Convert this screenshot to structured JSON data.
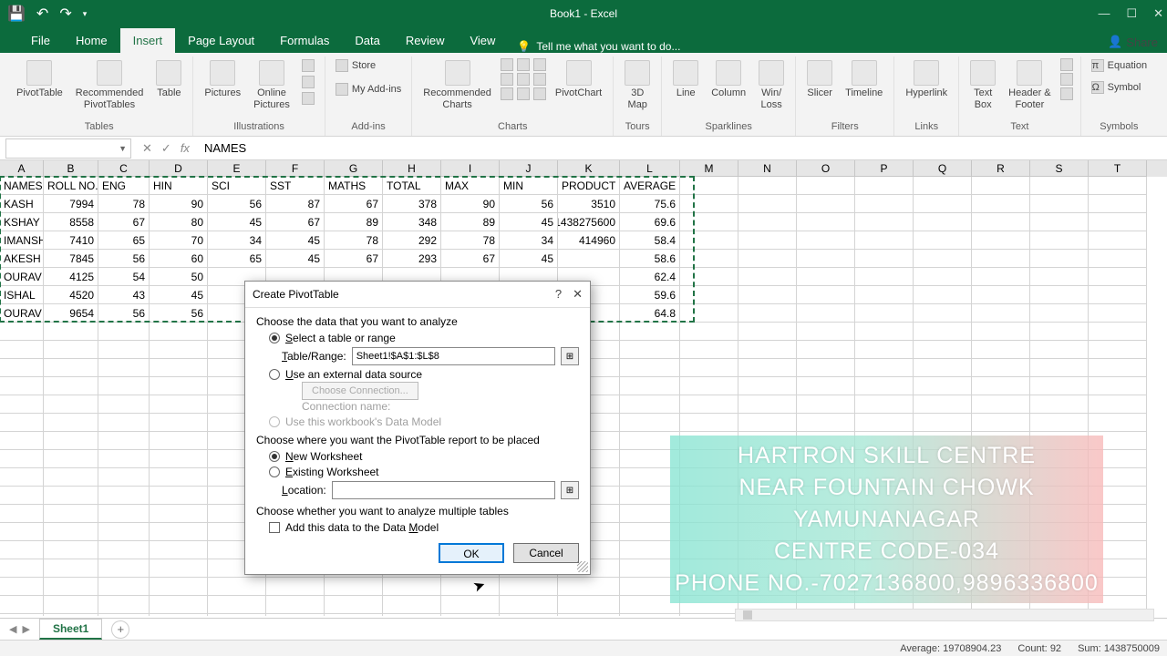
{
  "app": {
    "title": "Book1 - Excel"
  },
  "tabs": [
    "File",
    "Home",
    "Insert",
    "Page Layout",
    "Formulas",
    "Data",
    "Review",
    "View"
  ],
  "active_tab": "Insert",
  "tell_me": "Tell me what you want to do...",
  "share": "Share",
  "ribbon": {
    "tables": {
      "pivot": "PivotTable",
      "recommended": "Recommended\nPivotTables",
      "table": "Table",
      "group": "Tables"
    },
    "illustrations": {
      "pictures": "Pictures",
      "online": "Online\nPictures",
      "group": "Illustrations"
    },
    "addins": {
      "store": "Store",
      "my": "My Add-ins",
      "group": "Add-ins"
    },
    "charts": {
      "recommended": "Recommended\nCharts",
      "pivotchart": "PivotChart",
      "group": "Charts"
    },
    "tours": {
      "map": "3D\nMap",
      "group": "Tours"
    },
    "sparklines": {
      "line": "Line",
      "column": "Column",
      "winloss": "Win/\nLoss",
      "group": "Sparklines"
    },
    "filters": {
      "slicer": "Slicer",
      "timeline": "Timeline",
      "group": "Filters"
    },
    "links": {
      "hyperlink": "Hyperlink",
      "group": "Links"
    },
    "text": {
      "textbox": "Text\nBox",
      "header": "Header &\nFooter",
      "group": "Text"
    },
    "symbols": {
      "equation": "Equation",
      "symbol": "Symbol",
      "group": "Symbols"
    }
  },
  "formula_bar": {
    "name_box": "",
    "value": "NAMES",
    "fx": "fx"
  },
  "columns": [
    "A",
    "B",
    "C",
    "D",
    "E",
    "F",
    "G",
    "H",
    "I",
    "J",
    "K",
    "L",
    "M",
    "N",
    "O",
    "P",
    "Q",
    "R",
    "S",
    "T"
  ],
  "headers": [
    "NAMES",
    "ROLL NO.",
    "ENG",
    "HIN",
    "SCI",
    "SST",
    "MATHS",
    "TOTAL",
    "MAX",
    "MIN",
    "PRODUCT",
    "AVERAGE"
  ],
  "rows": [
    {
      "n": "KASH",
      "r": 7994,
      "c": [
        78,
        90,
        56,
        87,
        67,
        378,
        90,
        56,
        3510,
        75.6
      ]
    },
    {
      "n": "KSHAY",
      "r": 8558,
      "c": [
        67,
        80,
        45,
        67,
        89,
        348,
        89,
        45,
        1438275600,
        69.6
      ]
    },
    {
      "n": "IMANSH",
      "r": 7410,
      "c": [
        65,
        70,
        34,
        45,
        78,
        292,
        78,
        34,
        414960,
        58.4
      ]
    },
    {
      "n": "AKESH",
      "r": 7845,
      "c": [
        56,
        60,
        65,
        45,
        67,
        293,
        67,
        45,
        null,
        58.6
      ]
    },
    {
      "n": "OURAV",
      "r": 4125,
      "c": [
        54,
        50,
        null,
        null,
        null,
        null,
        null,
        null,
        null,
        62.4
      ]
    },
    {
      "n": "ISHAL",
      "r": 4520,
      "c": [
        43,
        45,
        null,
        null,
        null,
        null,
        null,
        null,
        null,
        59.6
      ]
    },
    {
      "n": "OURAV",
      "r": 9654,
      "c": [
        56,
        56,
        null,
        null,
        null,
        null,
        null,
        null,
        null,
        64.8
      ]
    }
  ],
  "dialog": {
    "title": "Create PivotTable",
    "section1": "Choose the data that you want to analyze",
    "opt_select": "Select a table or range",
    "table_range_label": "Table/Range:",
    "table_range_value": "Sheet1!$A$1:$L$8",
    "opt_external": "Use an external data source",
    "choose_conn": "Choose Connection...",
    "conn_name": "Connection name:",
    "opt_datamodel": "Use this workbook's Data Model",
    "section2": "Choose where you want the PivotTable report to be placed",
    "opt_new": "New Worksheet",
    "opt_existing": "Existing Worksheet",
    "location_label": "Location:",
    "section3": "Choose whether you want to analyze multiple tables",
    "chk_add": "Add this data to the Data Model",
    "ok": "OK",
    "cancel": "Cancel"
  },
  "watermark": {
    "l1": "HARTRON SKILL CENTRE",
    "l2": "NEAR FOUNTAIN CHOWK",
    "l3": "YAMUNANAGAR",
    "l4": "CENTRE CODE-034",
    "l5": "PHONE NO.-7027136800,9896336800"
  },
  "sheet": {
    "tab": "Sheet1"
  },
  "status": {
    "avg_label": "Average:",
    "avg": "19708904.23",
    "count_label": "Count:",
    "count": "92",
    "sum_label": "Sum:",
    "sum": "1438750009"
  }
}
